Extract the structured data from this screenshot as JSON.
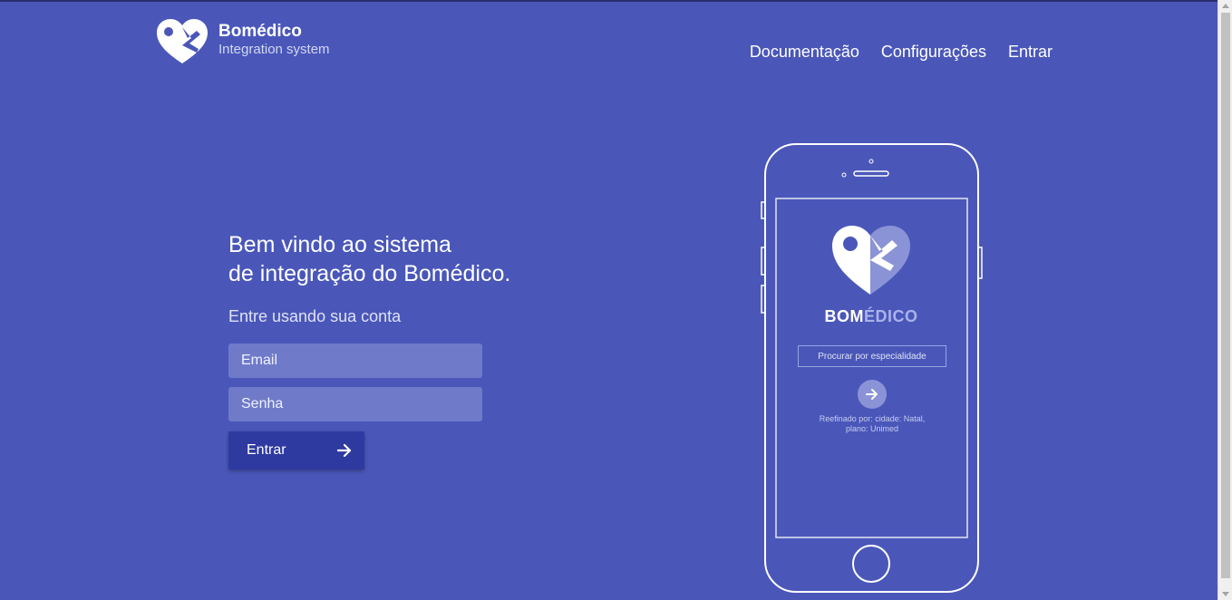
{
  "brand": {
    "name": "Bomédico",
    "tagline": "Integration system",
    "logo_icon": "heart-pin-logo"
  },
  "nav": {
    "items": [
      {
        "label": "Documentação"
      },
      {
        "label": "Configurações"
      },
      {
        "label": "Entrar"
      }
    ]
  },
  "hero": {
    "line1": "Bem vindo ao sistema",
    "line2_prefix": "de integração do ",
    "line2_brand": "Bomédico",
    "line2_suffix": ".",
    "subtitle": "Entre usando sua conta"
  },
  "form": {
    "email_placeholder": "Email",
    "password_placeholder": "Senha",
    "submit_label": "Entrar",
    "submit_icon": "arrow-right-icon"
  },
  "phone_mock": {
    "brand_part1": "BOM",
    "brand_part2": "ÉDICO",
    "search_placeholder": "Procurar por especialidade",
    "refine_text_line1": "Reefinado por: cidade: Natal,",
    "refine_text_line2": "plano:  Unimed"
  },
  "colors": {
    "background": "#4a57b9",
    "button": "#2f3aa0",
    "input": "#6f7bc9"
  }
}
